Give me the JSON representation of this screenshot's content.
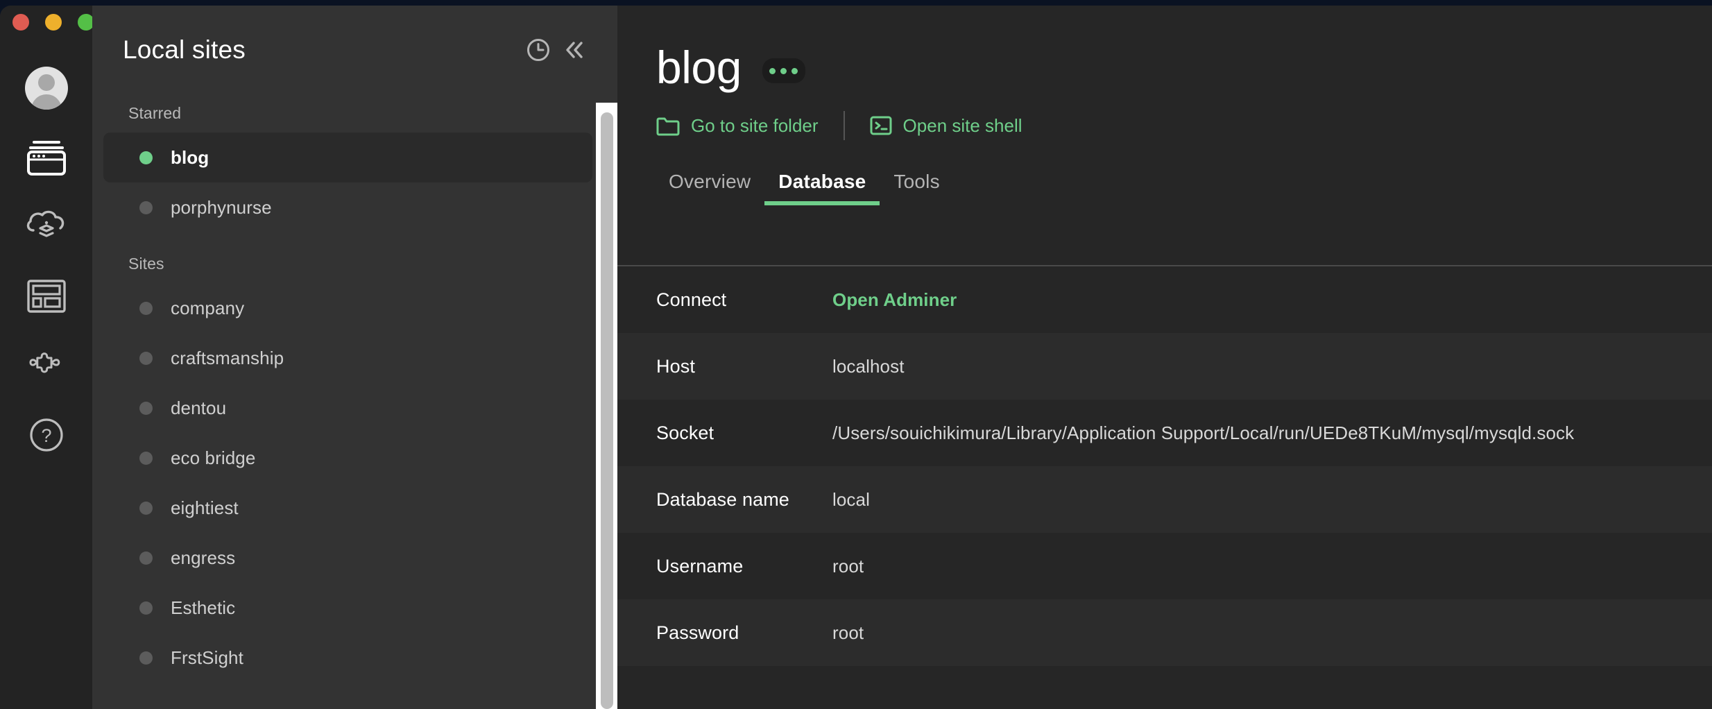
{
  "window": {
    "traffic_lights": [
      {
        "name": "close",
        "color": "#e05c52"
      },
      {
        "name": "minimize",
        "color": "#eeb02c"
      },
      {
        "name": "zoom",
        "color": "#54bf47"
      }
    ]
  },
  "rail": {
    "items": [
      {
        "icon": "user-avatar-icon",
        "label": "Account"
      },
      {
        "icon": "local-sites-icon",
        "label": "Local sites"
      },
      {
        "icon": "cloud-backups-icon",
        "label": "Cloud backups"
      },
      {
        "icon": "blueprints-icon",
        "label": "Blueprints"
      },
      {
        "icon": "add-ons-icon",
        "label": "Add-ons"
      },
      {
        "icon": "help-icon",
        "label": "Help"
      }
    ]
  },
  "sidebar": {
    "title": "Local sites",
    "header_icons": [
      {
        "icon": "clock-icon",
        "label": "Recent"
      },
      {
        "icon": "chevron-double-left-icon",
        "label": "Collapse"
      }
    ],
    "sections": [
      {
        "label": "Starred",
        "items": [
          {
            "name": "blog",
            "status": "running",
            "selected": true
          },
          {
            "name": "porphynurse",
            "status": "stopped",
            "selected": false
          }
        ]
      },
      {
        "label": "Sites",
        "items": [
          {
            "name": "company",
            "status": "stopped",
            "selected": false
          },
          {
            "name": "craftsmanship",
            "status": "stopped",
            "selected": false
          },
          {
            "name": "dentou",
            "status": "stopped",
            "selected": false
          },
          {
            "name": "eco bridge",
            "status": "stopped",
            "selected": false
          },
          {
            "name": "eightiest",
            "status": "stopped",
            "selected": false
          },
          {
            "name": "engress",
            "status": "stopped",
            "selected": false
          },
          {
            "name": "Esthetic",
            "status": "stopped",
            "selected": false
          },
          {
            "name": "FrstSight",
            "status": "stopped",
            "selected": false
          }
        ]
      }
    ]
  },
  "main": {
    "site_name": "blog",
    "menu_button_label": "•••",
    "actions": [
      {
        "icon": "folder-icon",
        "label": "Go to site folder"
      },
      {
        "icon": "terminal-icon",
        "label": "Open site shell"
      }
    ],
    "tabs": [
      {
        "label": "Overview",
        "active": false
      },
      {
        "label": "Database",
        "active": true
      },
      {
        "label": "Tools",
        "active": false
      }
    ],
    "rows": [
      {
        "label": "Connect",
        "value": "Open Adminer",
        "is_link": true
      },
      {
        "label": "Host",
        "value": "localhost",
        "is_link": false
      },
      {
        "label": "Socket",
        "value": "/Users/souichikimura/Library/Application Support/Local/run/UEDe8TKuM/mysql/mysqld.sock",
        "is_link": false
      },
      {
        "label": "Database name",
        "value": "local",
        "is_link": false
      },
      {
        "label": "Username",
        "value": "root",
        "is_link": false
      },
      {
        "label": "Password",
        "value": "root",
        "is_link": false
      }
    ]
  },
  "colors": {
    "accent_green": "#6fcf8a",
    "window_bg": "#262626",
    "sidebar_bg": "#333333",
    "rail_bg": "#232323",
    "selected_bg": "#2a2a2a",
    "row_alt_bg": "#2c2c2c"
  }
}
